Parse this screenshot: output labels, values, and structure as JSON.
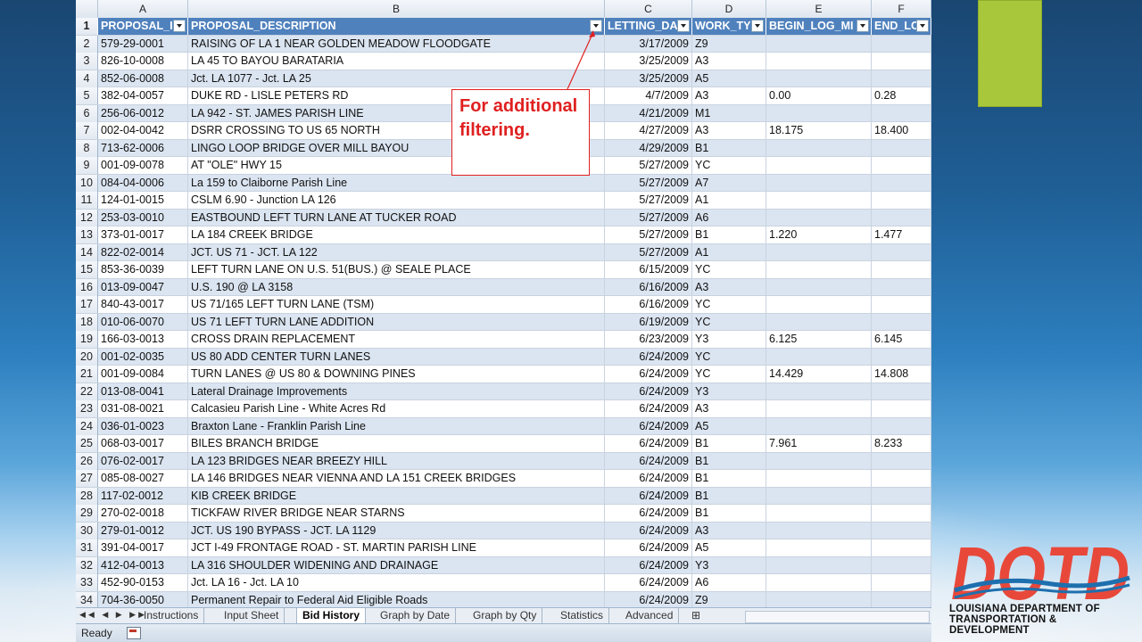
{
  "spreadsheet": {
    "column_letters": [
      "A",
      "B",
      "C",
      "D",
      "E",
      "F"
    ],
    "header_row_number": "1",
    "headers": [
      "PROPOSAL_ID",
      "PROPOSAL_DESCRIPTION",
      "LETTING_DA",
      "WORK_TYP",
      "BEGIN_LOG_MI",
      "END_LOG"
    ],
    "rows": [
      {
        "rn": "2",
        "id": "579-29-0001",
        "desc": "RAISING OF LA 1 NEAR GOLDEN MEADOW FLOODGATE",
        "date": "3/17/2009",
        "type": "Z9",
        "begin": "",
        "end": ""
      },
      {
        "rn": "3",
        "id": "826-10-0008",
        "desc": "LA 45 TO BAYOU BARATARIA",
        "date": "3/25/2009",
        "type": "A3",
        "begin": "",
        "end": ""
      },
      {
        "rn": "4",
        "id": "852-06-0008",
        "desc": "Jct. LA 1077 - Jct. LA 25",
        "date": "3/25/2009",
        "type": "A5",
        "begin": "",
        "end": ""
      },
      {
        "rn": "5",
        "id": "382-04-0057",
        "desc": "DUKE RD - LISLE PETERS RD",
        "date": "4/7/2009",
        "type": "A3",
        "begin": "0.00",
        "end": "0.28"
      },
      {
        "rn": "6",
        "id": "256-06-0012",
        "desc": "LA 942 - ST. JAMES PARISH LINE",
        "date": "4/21/2009",
        "type": "M1",
        "begin": "",
        "end": ""
      },
      {
        "rn": "7",
        "id": "002-04-0042",
        "desc": "DSRR CROSSING TO US 65 NORTH",
        "date": "4/27/2009",
        "type": "A3",
        "begin": "18.175",
        "end": "18.400"
      },
      {
        "rn": "8",
        "id": "713-62-0006",
        "desc": "LINGO LOOP BRIDGE OVER MILL BAYOU",
        "date": "4/29/2009",
        "type": "B1",
        "begin": "",
        "end": ""
      },
      {
        "rn": "9",
        "id": "001-09-0078",
        "desc": "AT \"OLE\" HWY 15",
        "date": "5/27/2009",
        "type": "YC",
        "begin": "",
        "end": ""
      },
      {
        "rn": "10",
        "id": "084-04-0006",
        "desc": "La 159 to Claiborne Parish Line",
        "date": "5/27/2009",
        "type": "A7",
        "begin": "",
        "end": ""
      },
      {
        "rn": "11",
        "id": "124-01-0015",
        "desc": "CSLM 6.90 - Junction LA 126",
        "date": "5/27/2009",
        "type": "A1",
        "begin": "",
        "end": ""
      },
      {
        "rn": "12",
        "id": "253-03-0010",
        "desc": "EASTBOUND LEFT TURN LANE AT TUCKER ROAD",
        "date": "5/27/2009",
        "type": "A6",
        "begin": "",
        "end": ""
      },
      {
        "rn": "13",
        "id": "373-01-0017",
        "desc": "LA 184 CREEK BRIDGE",
        "date": "5/27/2009",
        "type": "B1",
        "begin": "1.220",
        "end": "1.477"
      },
      {
        "rn": "14",
        "id": "822-02-0014",
        "desc": "JCT. US 71 - JCT. LA 122",
        "date": "5/27/2009",
        "type": "A1",
        "begin": "",
        "end": ""
      },
      {
        "rn": "15",
        "id": "853-36-0039",
        "desc": "LEFT TURN LANE ON U.S. 51(BUS.) @ SEALE PLACE",
        "date": "6/15/2009",
        "type": "YC",
        "begin": "",
        "end": ""
      },
      {
        "rn": "16",
        "id": "013-09-0047",
        "desc": "U.S. 190 @ LA 3158",
        "date": "6/16/2009",
        "type": "A3",
        "begin": "",
        "end": ""
      },
      {
        "rn": "17",
        "id": "840-43-0017",
        "desc": "US 71/165 LEFT TURN LANE (TSM)",
        "date": "6/16/2009",
        "type": "YC",
        "begin": "",
        "end": ""
      },
      {
        "rn": "18",
        "id": "010-06-0070",
        "desc": "US 71 LEFT TURN LANE ADDITION",
        "date": "6/19/2009",
        "type": "YC",
        "begin": "",
        "end": ""
      },
      {
        "rn": "19",
        "id": "166-03-0013",
        "desc": "CROSS DRAIN REPLACEMENT",
        "date": "6/23/2009",
        "type": "Y3",
        "begin": "6.125",
        "end": "6.145"
      },
      {
        "rn": "20",
        "id": "001-02-0035",
        "desc": "US 80 ADD CENTER TURN LANES",
        "date": "6/24/2009",
        "type": "YC",
        "begin": "",
        "end": ""
      },
      {
        "rn": "21",
        "id": "001-09-0084",
        "desc": "TURN LANES @ US 80 & DOWNING PINES",
        "date": "6/24/2009",
        "type": "YC",
        "begin": "14.429",
        "end": "14.808"
      },
      {
        "rn": "22",
        "id": "013-08-0041",
        "desc": "Lateral Drainage Improvements",
        "date": "6/24/2009",
        "type": "Y3",
        "begin": "",
        "end": ""
      },
      {
        "rn": "23",
        "id": "031-08-0021",
        "desc": "Calcasieu Parish Line - White Acres Rd",
        "date": "6/24/2009",
        "type": "A3",
        "begin": "",
        "end": ""
      },
      {
        "rn": "24",
        "id": "036-01-0023",
        "desc": "Braxton Lane - Franklin Parish Line",
        "date": "6/24/2009",
        "type": "A5",
        "begin": "",
        "end": ""
      },
      {
        "rn": "25",
        "id": "068-03-0017",
        "desc": "BILES BRANCH BRIDGE",
        "date": "6/24/2009",
        "type": "B1",
        "begin": "7.961",
        "end": "8.233"
      },
      {
        "rn": "26",
        "id": "076-02-0017",
        "desc": "LA 123 BRIDGES NEAR BREEZY HILL",
        "date": "6/24/2009",
        "type": "B1",
        "begin": "",
        "end": ""
      },
      {
        "rn": "27",
        "id": "085-08-0027",
        "desc": "LA 146 BRIDGES NEAR VIENNA AND LA 151 CREEK BRIDGES",
        "date": "6/24/2009",
        "type": "B1",
        "begin": "",
        "end": ""
      },
      {
        "rn": "28",
        "id": "117-02-0012",
        "desc": "KIB CREEK BRIDGE",
        "date": "6/24/2009",
        "type": "B1",
        "begin": "",
        "end": ""
      },
      {
        "rn": "29",
        "id": "270-02-0018",
        "desc": "TICKFAW RIVER BRIDGE NEAR STARNS",
        "date": "6/24/2009",
        "type": "B1",
        "begin": "",
        "end": ""
      },
      {
        "rn": "30",
        "id": "279-01-0012",
        "desc": "JCT. US 190 BYPASS - JCT. LA 1129",
        "date": "6/24/2009",
        "type": "A3",
        "begin": "",
        "end": ""
      },
      {
        "rn": "31",
        "id": "391-04-0017",
        "desc": "JCT I-49 FRONTAGE ROAD - ST. MARTIN PARISH LINE",
        "date": "6/24/2009",
        "type": "A5",
        "begin": "",
        "end": ""
      },
      {
        "rn": "32",
        "id": "412-04-0013",
        "desc": "LA 316 SHOULDER WIDENING AND DRAINAGE",
        "date": "6/24/2009",
        "type": "Y3",
        "begin": "",
        "end": ""
      },
      {
        "rn": "33",
        "id": "452-90-0153",
        "desc": "Jct. LA 16 - Jct. LA 10",
        "date": "6/24/2009",
        "type": "A6",
        "begin": "",
        "end": ""
      },
      {
        "rn": "34",
        "id": "704-36-0050",
        "desc": "Permanent Repair to Federal Aid Eligible Roads",
        "date": "6/24/2009",
        "type": "Z9",
        "begin": "",
        "end": ""
      }
    ]
  },
  "sheet_tabs": [
    "Instructions",
    "Input Sheet",
    "Bid History",
    "Graph by Date",
    "Graph by Qty",
    "Statistics",
    "Advanced"
  ],
  "active_tab": "Bid History",
  "status": {
    "ready": "Ready"
  },
  "annotation": {
    "text": "For additional filtering."
  },
  "logo": {
    "wordmark": "DOTD",
    "line1": "LOUISIANA DEPARTMENT OF",
    "line2": "TRANSPORTATION & DEVELOPMENT"
  },
  "colors": {
    "header_blue": "#4f81bd",
    "band_blue": "#dbe5f1",
    "accent_green": "#a8c73a",
    "annotation_red": "#e02020",
    "logo_red": "#e8483a"
  }
}
